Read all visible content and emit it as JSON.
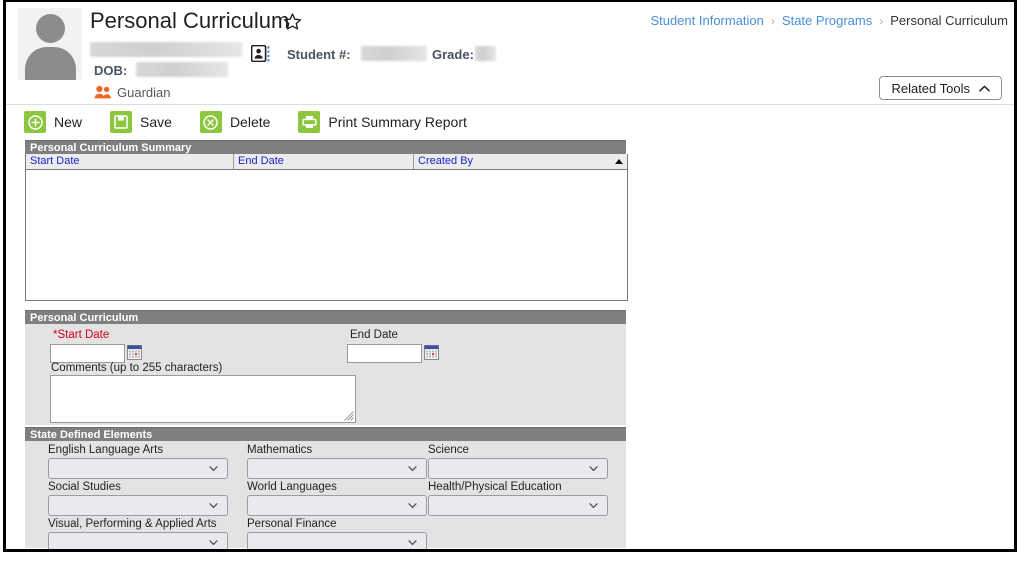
{
  "header": {
    "page_title": "Personal Curriculum",
    "favorite_icon": "star-outline-icon",
    "avatar_icon": "person-avatar-icon",
    "contact_card_icon": "contact-card-icon",
    "student_number_label": "Student #:",
    "grade_label": "Grade:",
    "dob_label": "DOB:",
    "guardian_label": "Guardian",
    "guardian_icon": "people-icon",
    "student_name_value": "",
    "dob_value": "",
    "student_number_value": "",
    "grade_value": "",
    "breadcrumb": [
      {
        "label": "Student Information",
        "current": false
      },
      {
        "label": "State Programs",
        "current": false
      },
      {
        "label": "Personal Curriculum",
        "current": true
      }
    ],
    "breadcrumb_separator": "›",
    "related_tools": {
      "label": "Related Tools",
      "icon": "chevron-up-icon"
    }
  },
  "toolbar": {
    "buttons": [
      {
        "label": "New",
        "icon": "plus-circle-icon"
      },
      {
        "label": "Save",
        "icon": "floppy-disk-icon"
      },
      {
        "label": "Delete",
        "icon": "x-circle-icon"
      },
      {
        "label": "Print Summary Report",
        "icon": "printer-icon"
      }
    ]
  },
  "summary": {
    "section_title": "Personal Curriculum Summary",
    "columns": [
      "Start Date",
      "End Date",
      "Created By"
    ],
    "sort_indicator": "ascending-sort-arrow",
    "rows": []
  },
  "personal_curriculum": {
    "section_title": "Personal Curriculum",
    "start_date": {
      "label": "*Start Date",
      "required": true,
      "value": "",
      "calendar_icon": "calendar-icon"
    },
    "end_date": {
      "label": "End Date",
      "required": false,
      "value": "",
      "calendar_icon": "calendar-icon"
    },
    "comments": {
      "label": "Comments (up to 255 characters)",
      "value": "",
      "resize_handle_icon": "resize-grip-icon"
    }
  },
  "state_defined_elements": {
    "section_title": "State Defined Elements",
    "fields": [
      {
        "label": "English Language Arts",
        "value": ""
      },
      {
        "label": "Mathematics",
        "value": ""
      },
      {
        "label": "Science",
        "value": ""
      },
      {
        "label": "Social Studies",
        "value": ""
      },
      {
        "label": "World Languages",
        "value": ""
      },
      {
        "label": "Health/Physical Education",
        "value": ""
      },
      {
        "label": "Visual, Performing & Applied Arts",
        "value": ""
      },
      {
        "label": "Personal Finance",
        "value": ""
      }
    ],
    "dropdown_icon": "chevron-down-icon"
  },
  "colors": {
    "accent_green": "#8dc63f",
    "link_blue": "#4a90d9",
    "column_header_blue": "#2222cc",
    "required_red": "#d0021b",
    "guardian_orange": "#f26522",
    "section_bar_gray": "#7f7f7f",
    "panel_gray": "#e3e3e3"
  }
}
